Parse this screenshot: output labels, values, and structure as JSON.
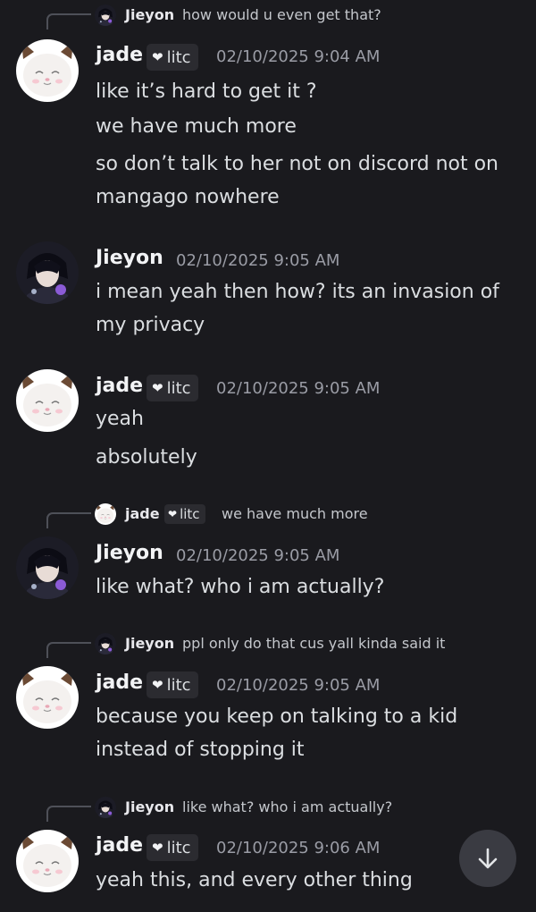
{
  "messages": [
    {
      "reply": {
        "author": "Jieyon",
        "text": "how would u even get that?"
      },
      "author": "jade",
      "badge": "litc",
      "time": "02/10/2025 9:04 AM",
      "lines": [
        "like it’s hard to get it ?",
        "we have much more",
        "so don’t talk to her not on discord not on",
        "mangago nowhere"
      ]
    },
    {
      "author": "Jieyon",
      "time": "02/10/2025 9:05 AM",
      "lines": [
        "i mean yeah then how? its an invasion of",
        "my privacy"
      ]
    },
    {
      "author": "jade",
      "badge": "litc",
      "time": "02/10/2025 9:05 AM",
      "lines": [
        "yeah",
        "absolutely"
      ]
    },
    {
      "reply": {
        "author": "jade",
        "badge": "litc",
        "text": "we have much more"
      },
      "author": "Jieyon",
      "time": "02/10/2025 9:05 AM",
      "lines": [
        "like what? who i am actually?"
      ]
    },
    {
      "reply": {
        "author": "Jieyon",
        "text": "ppl only do that cus yall kinda said it"
      },
      "author": "jade",
      "badge": "litc",
      "time": "02/10/2025 9:05 AM",
      "lines": [
        "because you keep on talking to a kid",
        "instead of stopping it"
      ]
    },
    {
      "reply": {
        "author": "Jieyon",
        "text": "like what? who i am actually?"
      },
      "author": "jade",
      "badge": "litc",
      "time": "02/10/2025 9:06 AM",
      "lines": [
        "yeah this, and every other thing"
      ]
    }
  ],
  "icons": {
    "scroll": "arrow-down-icon",
    "badge": "heart-icon"
  },
  "colors": {
    "background": "#1a1a1e",
    "text": "#dbdee1",
    "muted": "#9a9ca5"
  }
}
